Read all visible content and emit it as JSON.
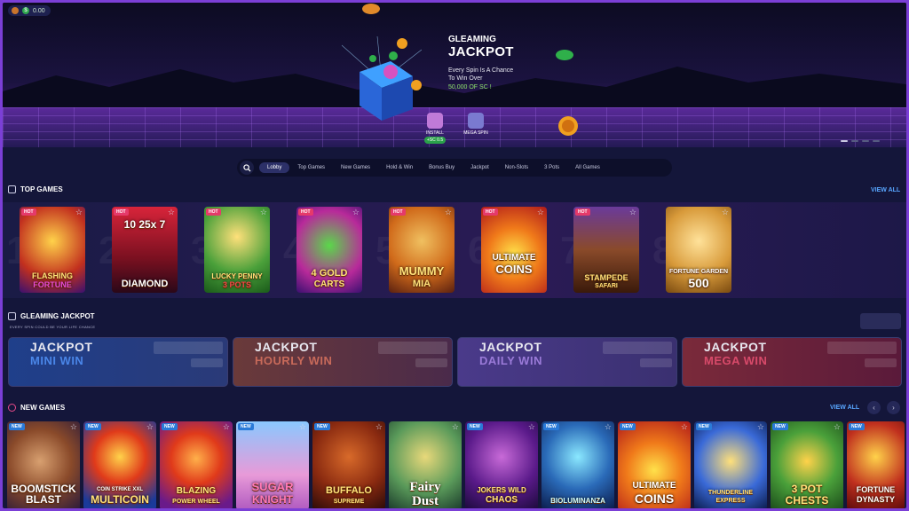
{
  "balance": {
    "sc_value": "0.00"
  },
  "hero": {
    "title_line1": "GLEAMING",
    "title_line2": "JACKPOT",
    "desc_line1": "Every Spin Is A Chance",
    "desc_line2": "To Win Over",
    "amount": "50,000 OF SC !",
    "install_label": "INSTALL",
    "install_reward": "+SC 0.5",
    "mega_spin_label": "MEGA SPIN"
  },
  "nav": {
    "tabs": [
      "Lobby",
      "Top Games",
      "New Games",
      "Hold & Win",
      "Bonus Buy",
      "Jackpot",
      "Non-Slots",
      "3 Pots",
      "All Games"
    ],
    "active": "Lobby"
  },
  "top_games": {
    "title": "TOP GAMES",
    "view_all": "VIEW ALL",
    "ranks": [
      "1",
      "2",
      "3",
      "4",
      "5",
      "6",
      "7",
      "8"
    ],
    "badge": "HOT",
    "games": [
      {
        "l1": "FLASHING",
        "l2": "FORTUNE"
      },
      {
        "l1": "10 25x 7",
        "l2": "DIAMOND"
      },
      {
        "l1": "LUCKY PENNY",
        "l2": "3 POTS"
      },
      {
        "l1": "4 GOLD",
        "l2": "CARTS"
      },
      {
        "l1": "MUMMY",
        "l2": "MIA"
      },
      {
        "l1": "ULTIMATE",
        "l2": "COINS"
      },
      {
        "l1": "STAMPEDE",
        "l2": "SAFARI"
      },
      {
        "l1": "FORTUNE GARDEN",
        "l2": "500"
      }
    ]
  },
  "jackpot": {
    "title": "GLEAMING JACKPOT",
    "subtitle": "EVERY SPIN COULD BE YOUR LIFE CHANCE",
    "cards": [
      {
        "l1": "JACKPOT",
        "l2": "MINI WIN"
      },
      {
        "l1": "JACKPOT",
        "l2": "HOURLY WIN"
      },
      {
        "l1": "JACKPOT",
        "l2": "DAILY WIN"
      },
      {
        "l1": "JACKPOT",
        "l2": "MEGA WIN"
      }
    ]
  },
  "new_games": {
    "title": "NEW GAMES",
    "view_all": "VIEW ALL",
    "badge": "NEW",
    "games": [
      {
        "l1": "BOOMSTICK",
        "l2": "BLAST"
      },
      {
        "l1": "COIN STRIKE XXL",
        "l2": "MULTICOIN"
      },
      {
        "l1": "BLAZING",
        "l2": "POWER WHEEL"
      },
      {
        "l1": "SUGAR",
        "l2": "KNIGHT"
      },
      {
        "l1": "BUFFALO",
        "l2": "SUPREME"
      },
      {
        "l1": "Fairy",
        "l2": "Dust"
      },
      {
        "l1": "JOKERS WILD",
        "l2": "CHAOS"
      },
      {
        "l1": "",
        "l2": "BIOLUMINANZA"
      },
      {
        "l1": "ULTIMATE",
        "l2": "COINS"
      },
      {
        "l1": "THUNDERLINE",
        "l2": "EXPRESS"
      },
      {
        "l1": "3 POT",
        "l2": "CHESTS"
      },
      {
        "l1": "FORTUNE",
        "l2": "DYNASTY"
      }
    ]
  }
}
